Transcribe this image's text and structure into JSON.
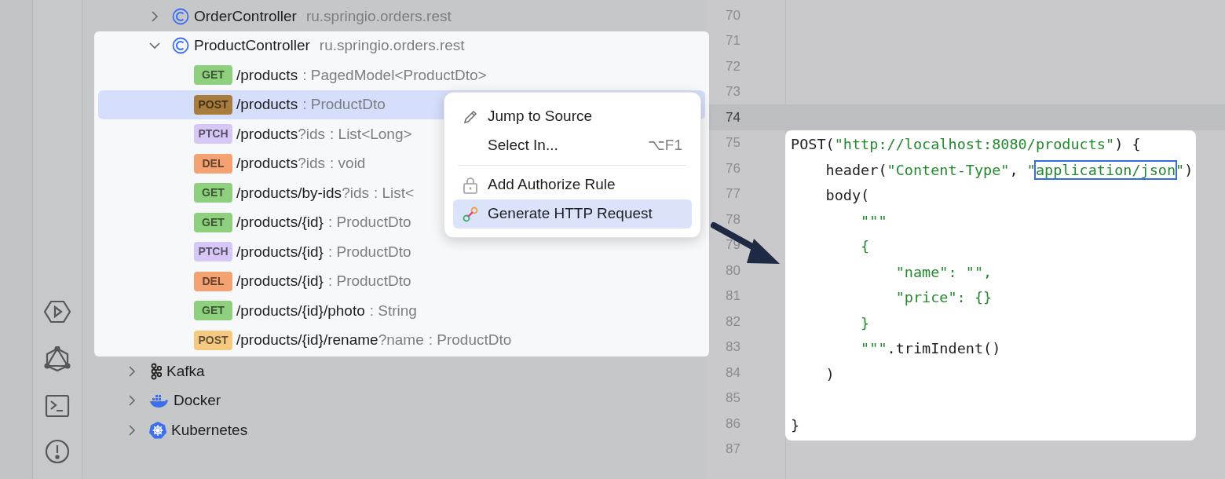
{
  "tree": {
    "nested_items": [
      {
        "label": "OrderController",
        "package": "ru.springio.orders.rest",
        "kind": "class",
        "expanded": false,
        "highlighted": false
      },
      {
        "label": "ProductController",
        "package": "ru.springio.orders.rest",
        "kind": "class",
        "expanded": true,
        "highlighted": true,
        "children": [
          {
            "method": "GET",
            "color": "#8fd07f",
            "path": "/products",
            "type": ": PagedModel<ProductDto>",
            "selected": false
          },
          {
            "method": "POST",
            "color": "#a87c3c",
            "path": "/products",
            "type": ": ProductDto",
            "selected": true
          },
          {
            "method": "PTCH",
            "color": "#d6c7f7",
            "path": "/products",
            "query": "?ids",
            "type": ": List<Long>",
            "selected": false
          },
          {
            "method": "DEL",
            "color": "#f4a272",
            "path": "/products",
            "query": "?ids",
            "type": ": void",
            "selected": false
          },
          {
            "method": "GET",
            "color": "#8fd07f",
            "path": "/products/by-ids",
            "query": "?ids",
            "type": ": List<",
            "selected": false
          },
          {
            "method": "GET",
            "color": "#8fd07f",
            "path": "/products/{id}",
            "type": ": ProductDto",
            "selected": false
          },
          {
            "method": "PTCH",
            "color": "#d6c7f7",
            "path": "/products/{id}",
            "type": ": ProductDto",
            "selected": false
          },
          {
            "method": "DEL",
            "color": "#f4a272",
            "path": "/products/{id}",
            "type": ": ProductDto",
            "selected": false
          },
          {
            "method": "GET",
            "color": "#8fd07f",
            "path": "/products/{id}/photo",
            "type": ": String",
            "selected": false
          },
          {
            "method": "POST",
            "color": "#f6c983",
            "path": "/products/{id}/rename",
            "query": "?name",
            "type": ": ProductDto",
            "selected": false
          }
        ]
      }
    ],
    "items": [
      {
        "label": "Kafka",
        "kind": "kafka",
        "expanded": false
      },
      {
        "label": "Docker",
        "kind": "docker",
        "expanded": false
      },
      {
        "label": "Kubernetes",
        "kind": "kubernetes",
        "expanded": false
      }
    ]
  },
  "context_menu": {
    "items": [
      {
        "label": "Jump to Source",
        "kind": "pencil",
        "selected": false,
        "separator_before": false
      },
      {
        "label": "Select In...",
        "kind": "plain",
        "shortcut": "⌥F1",
        "selected": false,
        "separator_before": false
      },
      {
        "label": "Add Authorize Rule",
        "kind": "lock",
        "selected": false,
        "separator_before": true
      },
      {
        "label": "Generate HTTP Request",
        "kind": "link",
        "selected": true,
        "separator_before": false
      }
    ]
  },
  "editor": {
    "line_numbers": [
      {
        "number": "70",
        "current": false
      },
      {
        "number": "71",
        "current": false
      },
      {
        "number": "72",
        "current": false
      },
      {
        "number": "73",
        "current": false
      },
      {
        "number": "74",
        "current": true
      },
      {
        "number": "75",
        "current": false
      },
      {
        "number": "76",
        "current": false
      },
      {
        "number": "77",
        "current": false
      },
      {
        "number": "78",
        "current": false
      },
      {
        "number": "79",
        "current": false
      },
      {
        "number": "80",
        "current": false
      },
      {
        "number": "81",
        "current": false
      },
      {
        "number": "82",
        "current": false
      },
      {
        "number": "83",
        "current": false
      },
      {
        "number": "84",
        "current": false
      },
      {
        "number": "85",
        "current": false
      },
      {
        "number": "86",
        "current": false
      },
      {
        "number": "87",
        "current": false
      }
    ],
    "snippet": {
      "lines": [
        {
          "kind": "code",
          "tokens": [
            {
              "kind": "plain",
              "text": "POST("
            },
            {
              "kind": "string",
              "text": "\"http://localhost:8080/products\""
            },
            {
              "kind": "plain",
              "text": ") {"
            }
          ]
        },
        {
          "kind": "code",
          "tokens": [
            {
              "kind": "plain",
              "text": "    header("
            },
            {
              "kind": "string",
              "text": "\"Content-Type\""
            },
            {
              "kind": "plain",
              "text": ", "
            },
            {
              "kind": "string",
              "text": "\""
            },
            {
              "kind": "boxed",
              "text": "application/json"
            },
            {
              "kind": "string",
              "text": "\""
            },
            {
              "kind": "plain",
              "text": ")"
            }
          ]
        },
        {
          "kind": "code",
          "tokens": [
            {
              "kind": "plain",
              "text": "    body("
            }
          ]
        },
        {
          "kind": "code",
          "tokens": [
            {
              "kind": "string",
              "text": "        \"\"\""
            }
          ]
        },
        {
          "kind": "code",
          "tokens": [
            {
              "kind": "string",
              "text": "        {"
            }
          ]
        },
        {
          "kind": "code",
          "tokens": [
            {
              "kind": "string",
              "text": "            \"name\": \"\","
            }
          ]
        },
        {
          "kind": "code",
          "tokens": [
            {
              "kind": "string",
              "text": "            \"price\": {}"
            }
          ]
        },
        {
          "kind": "code",
          "tokens": [
            {
              "kind": "string",
              "text": "        }"
            }
          ]
        },
        {
          "kind": "code",
          "tokens": [
            {
              "kind": "string",
              "text": "        \"\"\""
            },
            {
              "kind": "plain",
              "text": ".trimIndent()"
            }
          ]
        },
        {
          "kind": "code",
          "tokens": [
            {
              "kind": "plain",
              "text": "    )"
            }
          ]
        },
        {
          "kind": "blank"
        },
        {
          "kind": "code",
          "tokens": [
            {
              "kind": "plain",
              "text": "}"
            }
          ]
        }
      ]
    }
  }
}
